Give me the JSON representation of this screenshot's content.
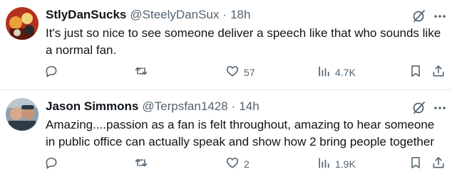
{
  "tweets": [
    {
      "display_name": "StlyDanSucks",
      "handle": "@SteelyDanSux",
      "separator": "·",
      "time": "18h",
      "text": "It's just so nice to see someone deliver a speech like that who sounds like a normal fan.",
      "reply_count": "",
      "retweet_count": "",
      "like_count": "57",
      "view_count": "4.7K",
      "avatar_colors": [
        "#c23b22",
        "#f0b63a"
      ]
    },
    {
      "display_name": "Jason Simmons",
      "handle": "@Terpsfan1428",
      "separator": "·",
      "time": "14h",
      "text": "Amazing....passion as a fan is felt throughout, amazing to hear someone in public office can actually  speak and show how 2 bring people together",
      "reply_count": "",
      "retweet_count": "",
      "like_count": "2",
      "view_count": "1.9K",
      "avatar_colors": [
        "#7d8f9c",
        "#3b4a58"
      ]
    }
  ],
  "icons": [
    "comment-icon",
    "retweet-icon",
    "heart-icon",
    "views-icon",
    "bookmark-icon",
    "share-icon",
    "grok-icon",
    "more-icon"
  ],
  "colors": {
    "text": "#0f1419",
    "secondary": "#536471",
    "divider": "#e3e7ea"
  }
}
